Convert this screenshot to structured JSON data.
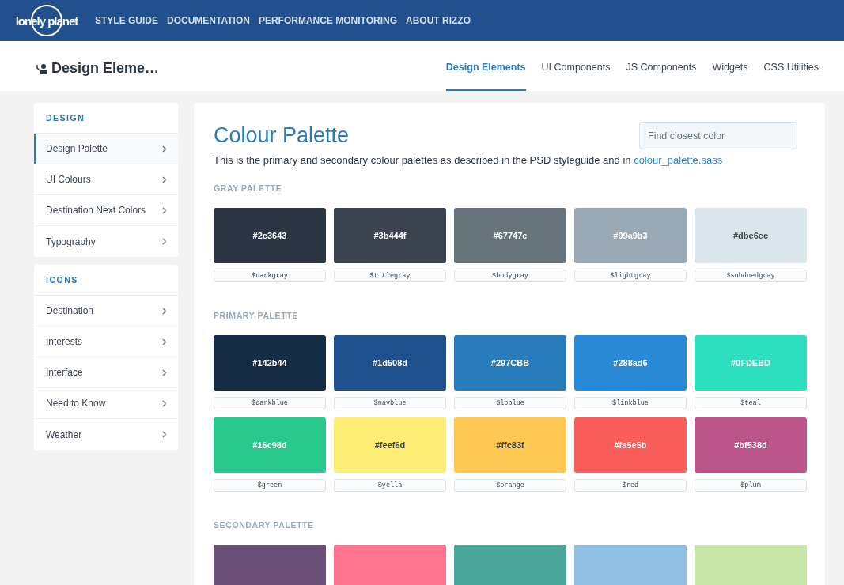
{
  "header": {
    "logo": "lonely planet",
    "nav": [
      "STYLE GUIDE",
      "DOCUMENTATION",
      "PERFORMANCE MONITORING",
      "ABOUT RIZZO"
    ]
  },
  "subheader": {
    "title": "Design Eleme…",
    "tabs": [
      {
        "label": "Design Elements",
        "selected": true
      },
      {
        "label": "UI Components",
        "selected": false
      },
      {
        "label": "JS Components",
        "selected": false
      },
      {
        "label": "Widgets",
        "selected": false
      },
      {
        "label": "CSS Utilities",
        "selected": false
      }
    ]
  },
  "sidebar": [
    {
      "heading": "DESIGN",
      "items": [
        {
          "label": "Design Palette",
          "selected": true
        },
        {
          "label": "UI Colours",
          "selected": false
        },
        {
          "label": "Destination Next Colors",
          "selected": false
        },
        {
          "label": "Typography",
          "selected": false
        }
      ]
    },
    {
      "heading": "ICONS",
      "items": [
        {
          "label": "Destination",
          "selected": false
        },
        {
          "label": "Interests",
          "selected": false
        },
        {
          "label": "Interface",
          "selected": false
        },
        {
          "label": "Need to Know",
          "selected": false
        },
        {
          "label": "Weather",
          "selected": false
        }
      ]
    }
  ],
  "content": {
    "title": "Colour Palette",
    "search": {
      "placeholder": "Find closest color"
    },
    "intro": "This is the primary and secondary colour palettes as described in the PSD styleguide and in",
    "intro_link": "colour_palette.sass",
    "palettes": [
      {
        "heading": "GRAY PALETTE",
        "swatches": [
          {
            "hex": "#2c3643",
            "variable": "$darkgray",
            "color": "#2c3643"
          },
          {
            "hex": "#3b444f",
            "variable": "$titlegray",
            "color": "#3b444f"
          },
          {
            "hex": "#67747c",
            "variable": "$bodygray",
            "color": "#67747c"
          },
          {
            "hex": "#99a9b3",
            "variable": "$lightgray",
            "color": "#99a9b3"
          },
          {
            "hex": "#dbe6ec",
            "variable": "$subduedgray",
            "color": "#dbe6ec"
          }
        ]
      },
      {
        "heading": "PRIMARY PALETTE",
        "swatches": [
          {
            "hex": "#142b44",
            "variable": "$darkblue",
            "color": "#142b44"
          },
          {
            "hex": "#1d508d",
            "variable": "$navblue",
            "color": "#1d508d"
          },
          {
            "hex": "#297CBB",
            "variable": "$lpblue",
            "color": "#297cbb"
          },
          {
            "hex": "#288ad6",
            "variable": "$linkblue",
            "color": "#288ad6"
          },
          {
            "hex": "#0FDEBD",
            "variable": "$teal",
            "color": "#2bdfbf"
          },
          {
            "hex": "#16c98d",
            "variable": "$green",
            "color": "#29c98d"
          },
          {
            "hex": "#feef6d",
            "variable": "$yella",
            "color": "#feed74"
          },
          {
            "hex": "#ffc83f",
            "variable": "$orange",
            "color": "#fec750"
          },
          {
            "hex": "#fa5e5b",
            "variable": "$red",
            "color": "#fa5e5b"
          },
          {
            "hex": "#bf538d",
            "variable": "$plum",
            "color": "#bb5488"
          }
        ]
      },
      {
        "heading": "SECONDARY PALETTE",
        "swatches": [
          {
            "color": "#6a5078"
          },
          {
            "color": "#ff7590"
          },
          {
            "color": "#4aa89a"
          },
          {
            "color": "#8fbfe3"
          },
          {
            "color": "#c8e6a8"
          }
        ]
      }
    ]
  }
}
